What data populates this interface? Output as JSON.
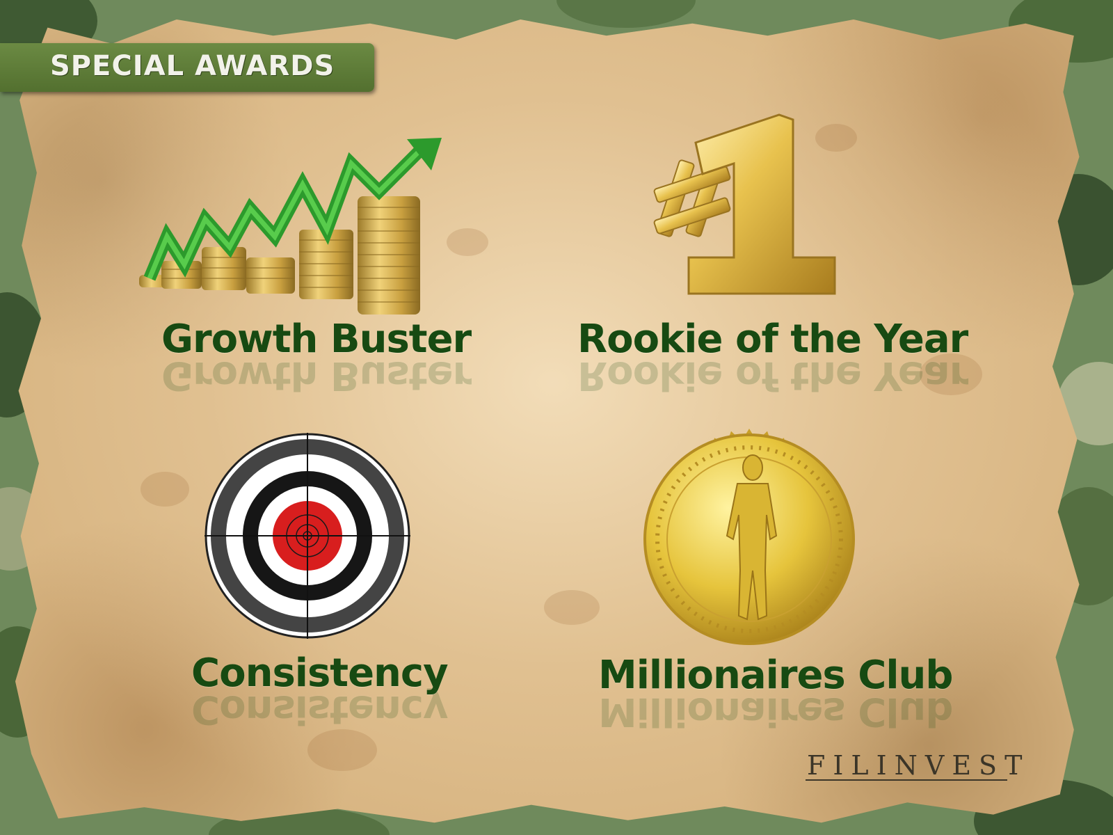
{
  "slide": {
    "title": "SPECIAL AWARDS",
    "awards": [
      {
        "label": "Growth Buster",
        "icon": "growth-chart-coins-icon"
      },
      {
        "label": "Rookie of the Year",
        "icon": "number-one-gold-icon"
      },
      {
        "label": "Consistency",
        "icon": "target-bullseye-icon"
      },
      {
        "label": "Millionaires Club",
        "icon": "gold-medal-man-icon"
      }
    ],
    "logo_text": "FILINVEST"
  },
  "colors": {
    "label_green": "#174a12",
    "banner_green": "#5e7d38",
    "parchment": "#d8b582",
    "camo": "#6f8a5c",
    "gold": "#d9b23a",
    "target_red": "#d81e1e"
  }
}
